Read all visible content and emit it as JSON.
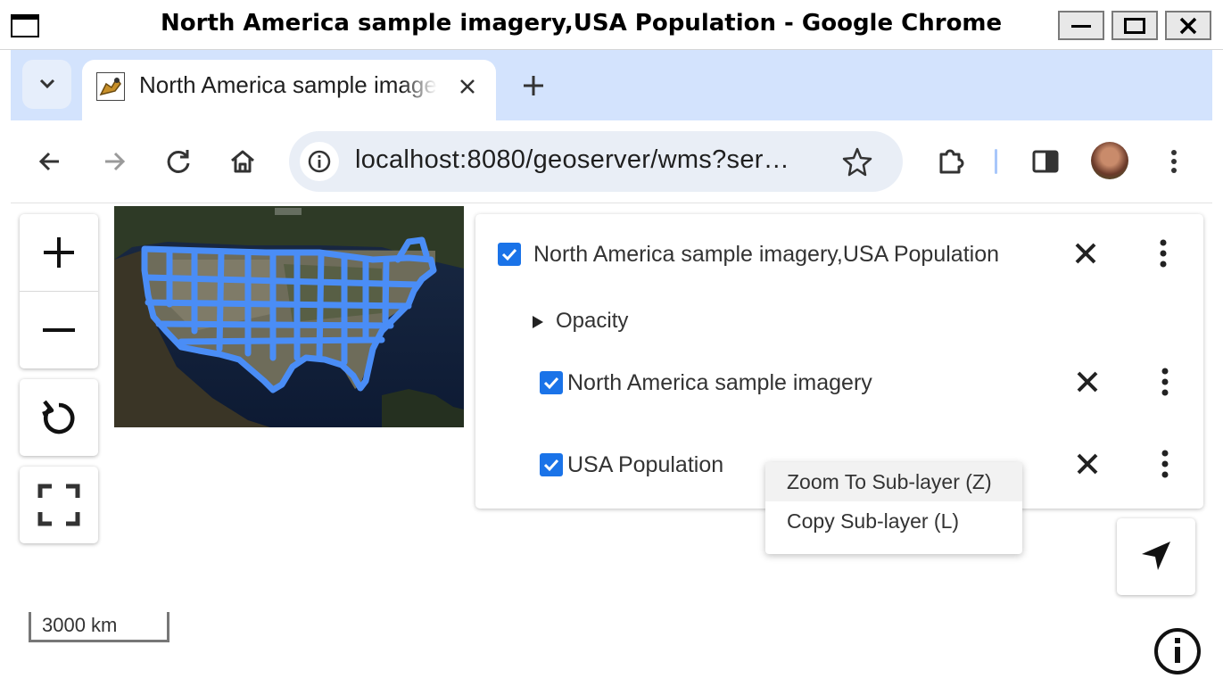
{
  "window": {
    "title": "North America sample imagery,USA Population - Google Chrome"
  },
  "browser": {
    "tab_title": "North America sample imagery,USA Population",
    "url": "localhost:8080/geoserver/wms?ser…"
  },
  "map": {
    "scale_label": "3000 km"
  },
  "layers": {
    "group": {
      "label": "North America sample imagery,USA Population",
      "checked": true
    },
    "opacity_label": "Opacity",
    "sublayers": [
      {
        "label": "North America sample imagery",
        "checked": true
      },
      {
        "label": "USA Population",
        "checked": true
      }
    ]
  },
  "context_menu": {
    "items": [
      {
        "label": "Zoom To Sub-layer (Z)",
        "highlighted": true
      },
      {
        "label": "Copy Sub-layer (L)",
        "highlighted": false
      }
    ]
  },
  "colors": {
    "accent": "#1a73e8",
    "state_outline": "#4a8df6",
    "chrome_frame": "#d3e3fd"
  },
  "icons": {
    "zoom_in": "plus-icon",
    "zoom_out": "minus-icon",
    "rotate": "rotate-icon",
    "fullscreen": "fullscreen-icon",
    "locate": "navigation-arrow-icon",
    "info": "info-icon"
  }
}
